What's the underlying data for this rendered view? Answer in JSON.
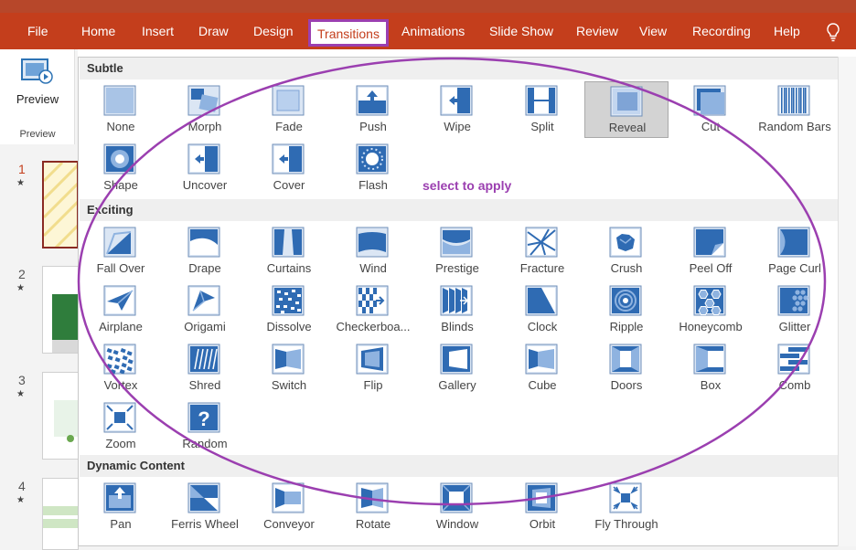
{
  "ribbon": {
    "tabs": [
      {
        "label": "File"
      },
      {
        "label": "Home"
      },
      {
        "label": "Insert"
      },
      {
        "label": "Draw"
      },
      {
        "label": "Design"
      },
      {
        "label": "Transitions"
      },
      {
        "label": "Animations"
      },
      {
        "label": "Slide Show"
      },
      {
        "label": "Review"
      },
      {
        "label": "View"
      },
      {
        "label": "Recording"
      },
      {
        "label": "Help"
      }
    ],
    "active_tab": "Transitions",
    "preview_label": "Preview",
    "preview_group_label": "Preview",
    "accent_color": "#c43e1c",
    "highlight_color": "#9b3fb0"
  },
  "slides": [
    {
      "number": "1",
      "star": "★"
    },
    {
      "number": "2",
      "star": "★"
    },
    {
      "number": "3",
      "star": "★"
    },
    {
      "number": "4",
      "star": "★"
    }
  ],
  "gallery": {
    "hint": "select to apply",
    "selected": "Reveal",
    "sections": [
      {
        "title": "Subtle",
        "items": [
          {
            "label": "None",
            "icon": "none-icon"
          },
          {
            "label": "Morph",
            "icon": "morph-icon"
          },
          {
            "label": "Fade",
            "icon": "fade-icon"
          },
          {
            "label": "Push",
            "icon": "push-icon"
          },
          {
            "label": "Wipe",
            "icon": "wipe-icon"
          },
          {
            "label": "Split",
            "icon": "split-icon"
          },
          {
            "label": "Reveal",
            "icon": "reveal-icon"
          },
          {
            "label": "Cut",
            "icon": "cut-icon"
          },
          {
            "label": "Random Bars",
            "icon": "random-bars-icon"
          },
          {
            "label": "Shape",
            "icon": "shape-icon"
          },
          {
            "label": "Uncover",
            "icon": "uncover-icon"
          },
          {
            "label": "Cover",
            "icon": "cover-icon"
          },
          {
            "label": "Flash",
            "icon": "flash-icon"
          }
        ]
      },
      {
        "title": "Exciting",
        "items": [
          {
            "label": "Fall Over",
            "icon": "fall-over-icon"
          },
          {
            "label": "Drape",
            "icon": "drape-icon"
          },
          {
            "label": "Curtains",
            "icon": "curtains-icon"
          },
          {
            "label": "Wind",
            "icon": "wind-icon"
          },
          {
            "label": "Prestige",
            "icon": "prestige-icon"
          },
          {
            "label": "Fracture",
            "icon": "fracture-icon"
          },
          {
            "label": "Crush",
            "icon": "crush-icon"
          },
          {
            "label": "Peel Off",
            "icon": "peel-off-icon"
          },
          {
            "label": "Page Curl",
            "icon": "page-curl-icon"
          },
          {
            "label": "Airplane",
            "icon": "airplane-icon"
          },
          {
            "label": "Origami",
            "icon": "origami-icon"
          },
          {
            "label": "Dissolve",
            "icon": "dissolve-icon"
          },
          {
            "label": "Checkerboa...",
            "icon": "checkerboard-icon"
          },
          {
            "label": "Blinds",
            "icon": "blinds-icon"
          },
          {
            "label": "Clock",
            "icon": "clock-icon"
          },
          {
            "label": "Ripple",
            "icon": "ripple-icon"
          },
          {
            "label": "Honeycomb",
            "icon": "honeycomb-icon"
          },
          {
            "label": "Glitter",
            "icon": "glitter-icon"
          },
          {
            "label": "Vortex",
            "icon": "vortex-icon"
          },
          {
            "label": "Shred",
            "icon": "shred-icon"
          },
          {
            "label": "Switch",
            "icon": "switch-icon"
          },
          {
            "label": "Flip",
            "icon": "flip-icon"
          },
          {
            "label": "Gallery",
            "icon": "gallery-icon"
          },
          {
            "label": "Cube",
            "icon": "cube-icon"
          },
          {
            "label": "Doors",
            "icon": "doors-icon"
          },
          {
            "label": "Box",
            "icon": "box-icon"
          },
          {
            "label": "Comb",
            "icon": "comb-icon"
          },
          {
            "label": "Zoom",
            "icon": "zoom-icon"
          },
          {
            "label": "Random",
            "icon": "random-icon"
          }
        ]
      },
      {
        "title": "Dynamic Content",
        "items": [
          {
            "label": "Pan",
            "icon": "pan-icon"
          },
          {
            "label": "Ferris Wheel",
            "icon": "ferris-wheel-icon"
          },
          {
            "label": "Conveyor",
            "icon": "conveyor-icon"
          },
          {
            "label": "Rotate",
            "icon": "rotate-icon"
          },
          {
            "label": "Window",
            "icon": "window-icon"
          },
          {
            "label": "Orbit",
            "icon": "orbit-icon"
          },
          {
            "label": "Fly Through",
            "icon": "fly-through-icon"
          }
        ]
      }
    ]
  }
}
